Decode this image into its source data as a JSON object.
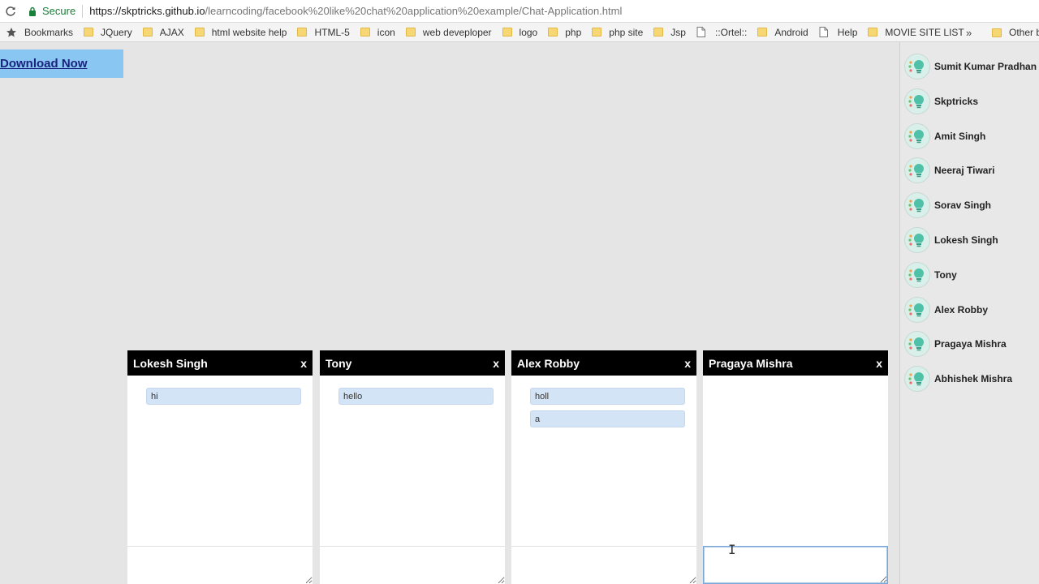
{
  "browser": {
    "secure_label": "Secure",
    "url_host": "https://skptricks.github.io",
    "url_path": "/learncoding/facebook%20like%20chat%20application%20example/Chat-Application.html"
  },
  "bookmarks": {
    "items": [
      {
        "label": "Bookmarks",
        "icon": "star-icon"
      },
      {
        "label": "JQuery",
        "icon": "folder-icon"
      },
      {
        "label": "AJAX",
        "icon": "folder-icon"
      },
      {
        "label": "html website help",
        "icon": "folder-icon"
      },
      {
        "label": "HTML-5",
        "icon": "folder-icon"
      },
      {
        "label": "icon",
        "icon": "folder-icon"
      },
      {
        "label": "web deveploper",
        "icon": "folder-icon"
      },
      {
        "label": "logo",
        "icon": "folder-icon"
      },
      {
        "label": "php",
        "icon": "folder-icon"
      },
      {
        "label": "php site",
        "icon": "folder-icon"
      },
      {
        "label": "Jsp",
        "icon": "folder-icon"
      },
      {
        "label": "::Ortel::",
        "icon": "page-icon"
      },
      {
        "label": "Android",
        "icon": "folder-icon"
      },
      {
        "label": "Help",
        "icon": "page-icon"
      },
      {
        "label": "MOVIE SITE LIST",
        "icon": "folder-icon"
      }
    ],
    "overflow": "»",
    "other": "Other bo"
  },
  "page": {
    "download_label": "Download Now"
  },
  "sidebar": {
    "contacts": [
      "Sumit Kumar Pradhan",
      "Skptricks",
      "Amit Singh",
      "Neeraj Tiwari",
      "Sorav Singh",
      "Lokesh Singh",
      "Tony",
      "Alex Robby",
      "Pragaya Mishra",
      "Abhishek Mishra"
    ]
  },
  "chats": [
    {
      "title": "Lokesh Singh",
      "close": "x",
      "messages": [
        "hi"
      ]
    },
    {
      "title": "Tony",
      "close": "x",
      "messages": [
        "hello"
      ]
    },
    {
      "title": "Alex Robby",
      "close": "x",
      "messages": [
        "holl",
        "a"
      ]
    },
    {
      "title": "Pragaya Mishra",
      "close": "x",
      "messages": []
    }
  ],
  "colors": {
    "header": "#000000",
    "message_bg": "#d4e4f7",
    "download_bg": "#89c7f2",
    "secure_green": "#188038"
  }
}
